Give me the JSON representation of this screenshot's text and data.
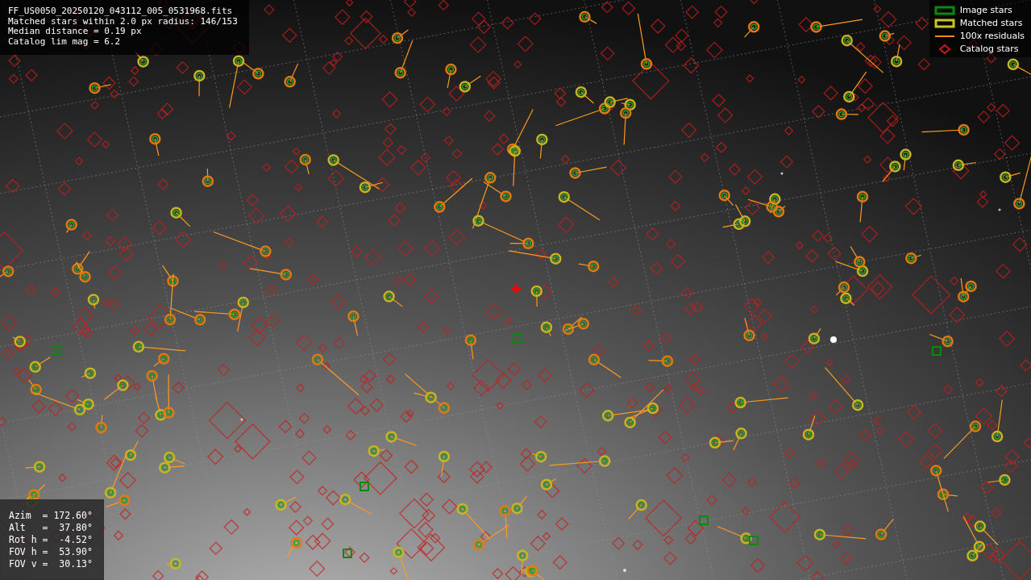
{
  "file_info": {
    "lines": [
      "FF_US0050_20250120_043112_005_0531968.fits",
      "Matched stars within 2.0 px radius: 146/153",
      "Median distance = 0.19 px",
      "Catalog lim mag = 6.2"
    ]
  },
  "legend": {
    "items": [
      {
        "label": "Image stars",
        "color": "#0a8a0a"
      },
      {
        "kind": "matched",
        "label": "Matched stars",
        "color": "#c8c81e"
      },
      {
        "kind": "residual",
        "label": "100x residuals",
        "color": "#ff8c1a"
      },
      {
        "kind": "catalog",
        "label": "Catalog stars",
        "color": "#cc1a1a"
      }
    ]
  },
  "pointing": {
    "lines": [
      "Azim  = 172.60°",
      "Alt   =  37.80°",
      "Rot h =  -4.52°",
      "FOV h =  53.90°",
      "FOV v =  30.13°"
    ]
  }
}
